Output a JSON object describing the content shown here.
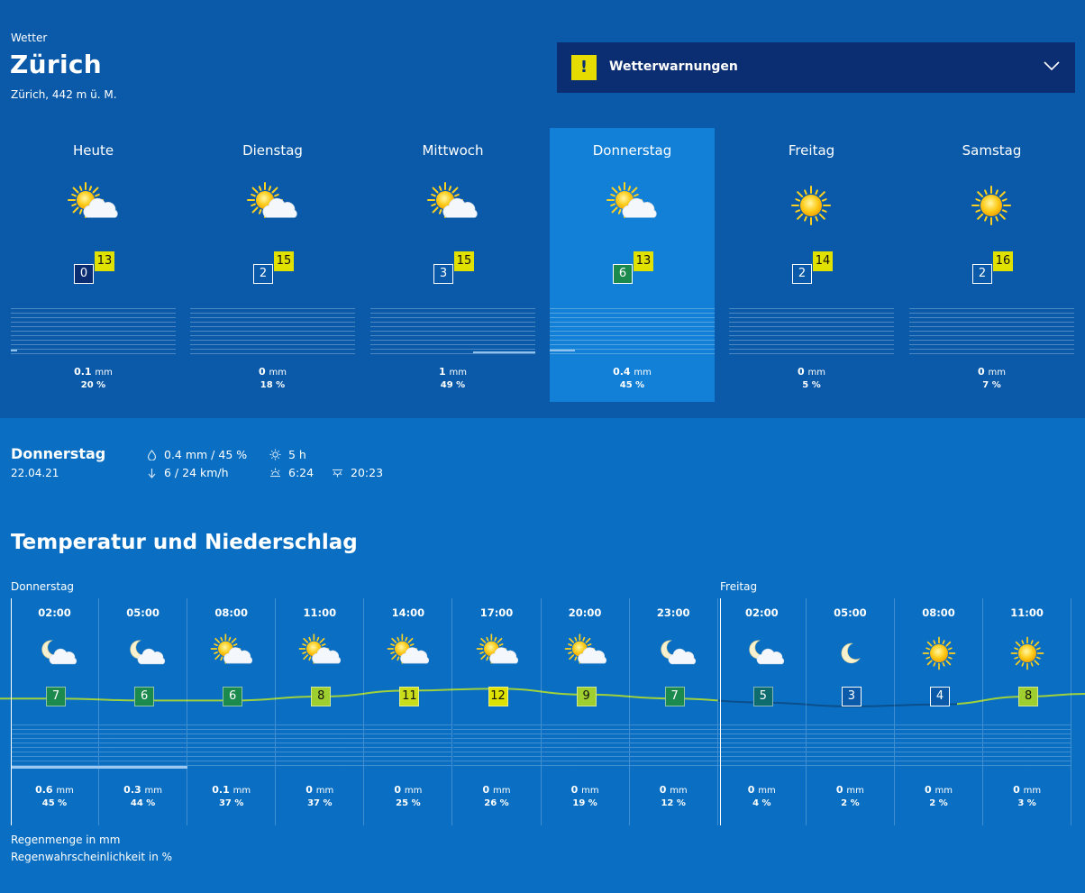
{
  "header": {
    "overline": "Wetter",
    "city": "Zürich",
    "subtitle": "Zürich, 442 m ü. M."
  },
  "warnings": {
    "label": "Wetterwarnungen",
    "badge": "!",
    "icon": "warning-icon"
  },
  "days": [
    {
      "name": "Heute",
      "icon": "sun-cloud",
      "tmin": "0",
      "tmax": "13",
      "tmin_color": "#0b2d72",
      "rain_value": "0.1",
      "rain_unit": "mm",
      "prob": "20 %",
      "selected": false
    },
    {
      "name": "Dienstag",
      "icon": "sun-cloud",
      "tmin": "2",
      "tmax": "15",
      "tmin_color": "#0a5aa9",
      "rain_value": "0",
      "rain_unit": "mm",
      "prob": "18 %",
      "selected": false
    },
    {
      "name": "Mittwoch",
      "icon": "sun-cloud",
      "tmin": "3",
      "tmax": "15",
      "tmin_color": "#0a5aa9",
      "rain_value": "1",
      "rain_unit": "mm",
      "prob": "49 %",
      "selected": false
    },
    {
      "name": "Donnerstag",
      "icon": "sun-cloud",
      "tmin": "6",
      "tmax": "13",
      "tmin_color": "#1d8a4d",
      "rain_value": "0.4",
      "rain_unit": "mm",
      "prob": "45 %",
      "selected": true
    },
    {
      "name": "Freitag",
      "icon": "sun",
      "tmin": "2",
      "tmax": "14",
      "tmin_color": "#0a5aa9",
      "rain_value": "0",
      "rain_unit": "mm",
      "prob": "5 %",
      "selected": false
    },
    {
      "name": "Samstag",
      "icon": "sun",
      "tmin": "2",
      "tmax": "16",
      "tmin_color": "#0a5aa9",
      "rain_value": "0",
      "rain_unit": "mm",
      "prob": "7 %",
      "selected": false
    }
  ],
  "detail": {
    "day": "Donnerstag",
    "date": "22.04.21",
    "rain": "0.4 mm / 45 %",
    "wind": "6 / 24 km/h",
    "sunshine": "5 h",
    "sunrise": "6:24",
    "sunset": "20:23"
  },
  "section_title": "Temperatur und Niederschlag",
  "day_labels": [
    "Donnerstag",
    "Freitag"
  ],
  "hourly": [
    {
      "time": "02:00",
      "icon": "moon-cloud",
      "temp": "7",
      "color": "#1d8a4d",
      "style": "fill",
      "rain_value": "0.6",
      "rain_unit": "mm",
      "prob": "45 %"
    },
    {
      "time": "05:00",
      "icon": "moon-cloud",
      "temp": "6",
      "color": "#1d8a4d",
      "style": "fill",
      "rain_value": "0.3",
      "rain_unit": "mm",
      "prob": "44 %"
    },
    {
      "time": "08:00",
      "icon": "sun-cloud",
      "temp": "6",
      "color": "#1d8a4d",
      "style": "fill",
      "rain_value": "0.1",
      "rain_unit": "mm",
      "prob": "37 %"
    },
    {
      "time": "11:00",
      "icon": "sun-cloud",
      "temp": "8",
      "color": "#9fcf2e",
      "style": "fill",
      "rain_value": "0",
      "rain_unit": "mm",
      "prob": "37 %"
    },
    {
      "time": "14:00",
      "icon": "sun-cloud",
      "temp": "11",
      "color": "#c9dd1a",
      "style": "fill",
      "rain_value": "0",
      "rain_unit": "mm",
      "prob": "25 %"
    },
    {
      "time": "17:00",
      "icon": "sun-cloud",
      "temp": "12",
      "color": "#dfe100",
      "style": "fill",
      "rain_value": "0",
      "rain_unit": "mm",
      "prob": "26 %"
    },
    {
      "time": "20:00",
      "icon": "sun-cloud",
      "temp": "9",
      "color": "#9fcf2e",
      "style": "fill",
      "rain_value": "0",
      "rain_unit": "mm",
      "prob": "19 %"
    },
    {
      "time": "23:00",
      "icon": "moon-cloud",
      "temp": "7",
      "color": "#1d8a4d",
      "style": "fill",
      "rain_value": "0",
      "rain_unit": "mm",
      "prob": "12 %"
    },
    {
      "time": "02:00",
      "icon": "moon-cloud",
      "temp": "5",
      "color": "#0e6c6e",
      "style": "fill",
      "rain_value": "0",
      "rain_unit": "mm",
      "prob": "4 %"
    },
    {
      "time": "05:00",
      "icon": "moon",
      "temp": "3",
      "color": "#0a5aa9",
      "style": "fill",
      "rain_value": "0",
      "rain_unit": "mm",
      "prob": "2 %"
    },
    {
      "time": "08:00",
      "icon": "sun",
      "temp": "4",
      "color": "#0a5aa9",
      "style": "fill",
      "rain_value": "0",
      "rain_unit": "mm",
      "prob": "2 %"
    },
    {
      "time": "11:00",
      "icon": "sun",
      "temp": "8",
      "color": "#9fcf2e",
      "style": "fill",
      "rain_value": "0",
      "rain_unit": "mm",
      "prob": "3 %"
    }
  ],
  "legend": {
    "amount": "Regenmenge in mm",
    "probability": "Regenwahrscheinlichkeit in %"
  }
}
